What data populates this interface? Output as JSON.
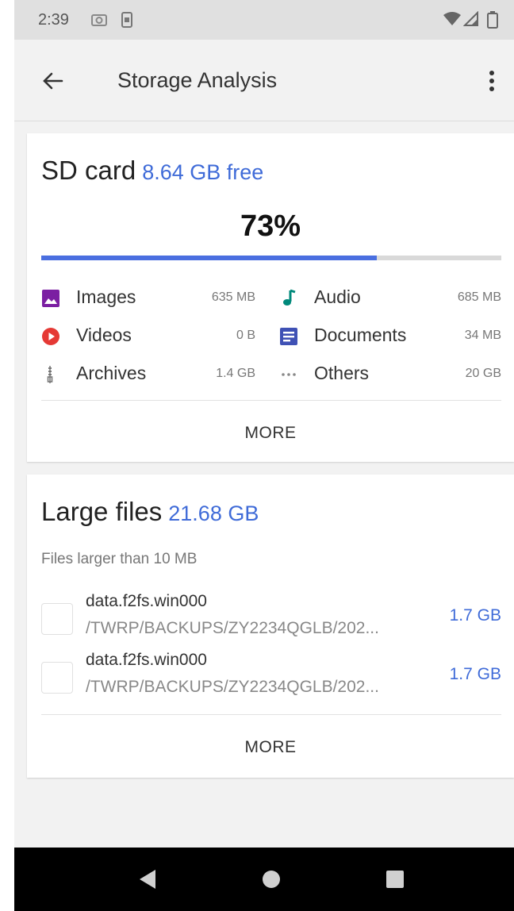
{
  "status": {
    "time": "2:39"
  },
  "toolbar": {
    "title": "Storage Analysis"
  },
  "sd_card": {
    "title": "SD card",
    "free": "8.64 GB free",
    "percent_label": "73%",
    "progress": 0.73,
    "categories": [
      {
        "label": "Images",
        "size": "635 MB",
        "icon": "image-icon",
        "color": "#7b1fa2"
      },
      {
        "label": "Audio",
        "size": "685 MB",
        "icon": "music-note-icon",
        "color": "#00897b"
      },
      {
        "label": "Videos",
        "size": "0 B",
        "icon": "play-circle-icon",
        "color": "#e53935"
      },
      {
        "label": "Documents",
        "size": "34 MB",
        "icon": "document-icon",
        "color": "#3f51b5"
      },
      {
        "label": "Archives",
        "size": "1.4 GB",
        "icon": "archive-zipper-icon",
        "color": "#757575"
      },
      {
        "label": "Others",
        "size": "20 GB",
        "icon": "more-horizontal-icon",
        "color": "#757575"
      }
    ],
    "more_label": "MORE"
  },
  "large_files": {
    "title": "Large files",
    "total": "21.68 GB",
    "subtitle": "Files larger than 10 MB",
    "files": [
      {
        "name": "data.f2fs.win000",
        "path": "/TWRP/BACKUPS/ZY2234QGLB/202...",
        "size": "1.7 GB"
      },
      {
        "name": "data.f2fs.win000",
        "path": "/TWRP/BACKUPS/ZY2234QGLB/202...",
        "size": "1.7 GB"
      }
    ],
    "more_label": "MORE"
  },
  "colors": {
    "accent": "#3f6bd8",
    "progress": "#4a6fe0"
  }
}
